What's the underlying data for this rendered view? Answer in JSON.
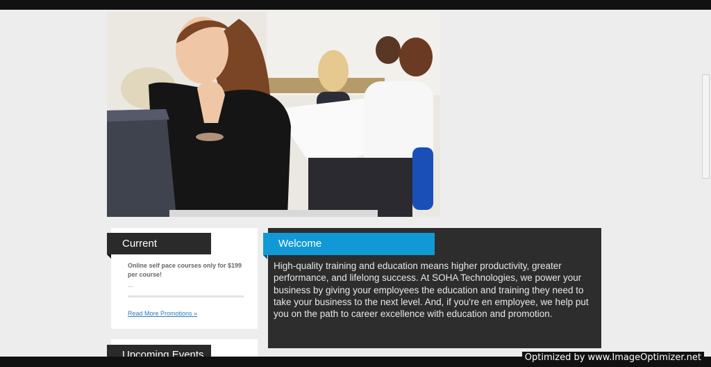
{
  "promotions": {
    "heading": "Current Promotions",
    "text": "Online self pace courses only for $199 per course!",
    "ellipsis": "...",
    "link": "Read More Promotions »"
  },
  "events": {
    "heading": "Upcoming Events"
  },
  "welcome": {
    "heading": "Welcome",
    "body": "High-quality training and education means higher productivity, greater performance, and lifelong success. At SOHA Technologies, we power your business by giving your employees the education and training they need to take your business to the next level. And, if you're en employee, we help put you on the path to career excellence with education and promotion."
  },
  "watermark": "Optimized by www.ImageOptimizer.net",
  "colors": {
    "accent": "#1199d6",
    "dark_panel": "#2d2d2d",
    "tab_dark": "#2a2a2a",
    "link": "#2a7ab8"
  }
}
